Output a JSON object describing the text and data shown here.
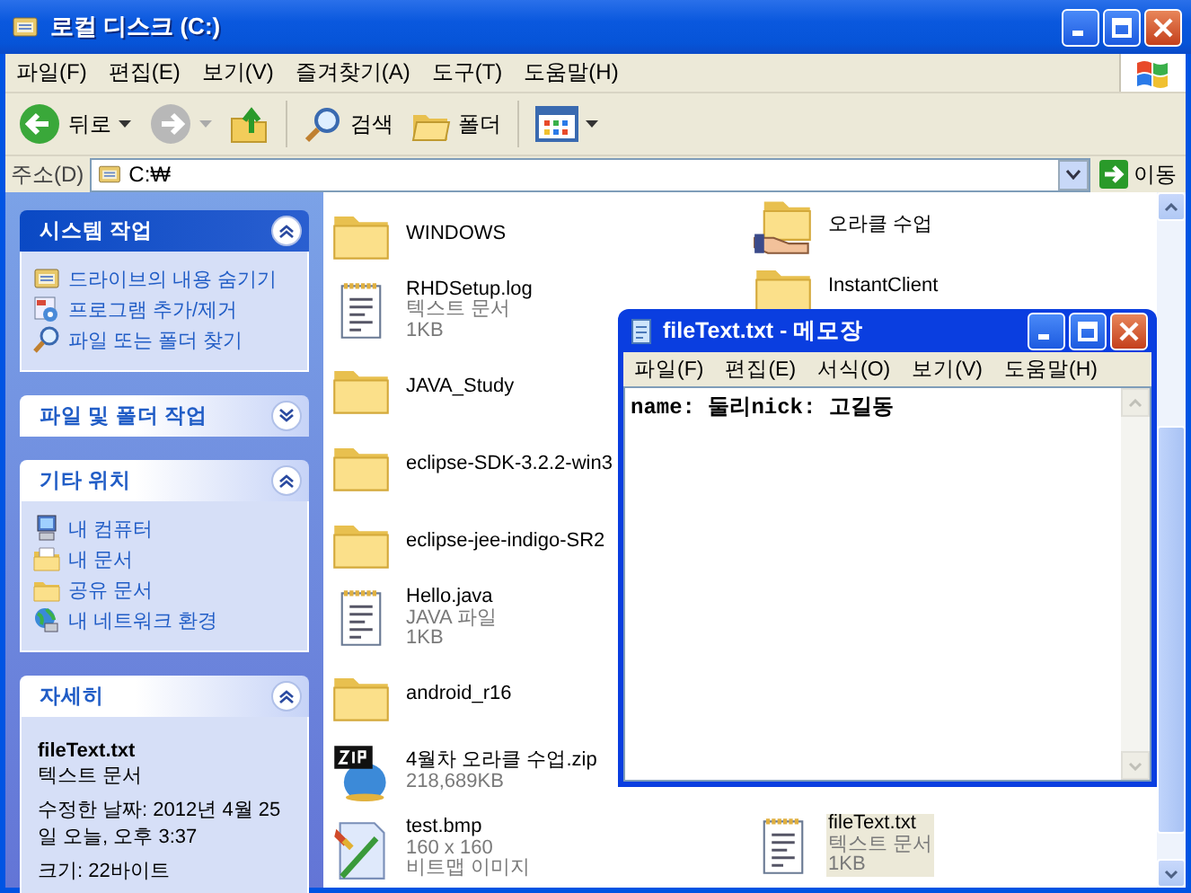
{
  "window": {
    "title": "로컬 디스크 (C:)"
  },
  "menu": [
    "파일(F)",
    "편집(E)",
    "보기(V)",
    "즐겨찾기(A)",
    "도구(T)",
    "도움말(H)"
  ],
  "toolbar": {
    "back": "뒤로",
    "search": "검색",
    "folders": "폴더"
  },
  "address": {
    "label": "주소(D)",
    "value": "C:₩",
    "go": "이동"
  },
  "task_panes": [
    {
      "title": "시스템 작업",
      "expanded": true,
      "items": [
        {
          "kind": "drive",
          "label": "드라이브의 내용 숨기기"
        },
        {
          "kind": "programs",
          "label": "프로그램 추가/제거"
        },
        {
          "kind": "search",
          "label": "파일 또는 폴더 찾기"
        }
      ]
    },
    {
      "title": "파일 및 폴더 작업",
      "expanded": false
    },
    {
      "title": "기타 위치",
      "expanded": true,
      "items": [
        {
          "kind": "computer",
          "label": "내 컴퓨터"
        },
        {
          "kind": "documents",
          "label": "내 문서"
        },
        {
          "kind": "shared",
          "label": "공유 문서"
        },
        {
          "kind": "network",
          "label": "내 네트워크 환경"
        }
      ]
    },
    {
      "title": "자세히",
      "expanded": true,
      "details": {
        "name": "fileText.txt",
        "type": "텍스트 문서",
        "modified": "수정한 날짜: 2012년 4월 25일 오늘, 오후 3:37",
        "size": "크기: 22바이트"
      }
    }
  ],
  "files": [
    [
      {
        "kind": "folder",
        "name": "WINDOWS",
        "selected": false
      },
      {
        "kind": "text",
        "name": "RHDSetup.log",
        "lines": [
          "텍스트 문서",
          "1KB"
        ],
        "selected": false
      },
      {
        "kind": "folder",
        "name": "JAVA_Study",
        "selected": false
      },
      {
        "kind": "folder",
        "name": "eclipse-SDK-3.2.2-win3",
        "selected": false
      },
      {
        "kind": "folder",
        "name": "eclipse-jee-indigo-SR2",
        "selected": false
      },
      {
        "kind": "text",
        "name": "Hello.java",
        "lines": [
          "JAVA 파일",
          "1KB"
        ],
        "selected": false
      },
      {
        "kind": "folder",
        "name": "android_r16",
        "selected": false
      },
      {
        "kind": "zip",
        "name": "4월차 오라클 수업.zip",
        "lines": [
          "218,689KB"
        ],
        "selected": false
      },
      {
        "kind": "image",
        "name": "test.bmp",
        "lines": [
          "160 x 160",
          "비트맵 이미지"
        ],
        "selected": false
      }
    ],
    [
      {
        "kind": "shared-folder",
        "name": "오라클 수업",
        "selected": false
      },
      {
        "kind": "folder",
        "name": "InstantClient",
        "selected": false
      },
      {
        "kind": "text",
        "name": "fileText.txt",
        "lines": [
          "텍스트 문서",
          "1KB"
        ],
        "selected": true
      }
    ]
  ],
  "notepad": {
    "title": "fileText.txt - 메모장",
    "menu": [
      "파일(F)",
      "편집(E)",
      "서식(O)",
      "보기(V)",
      "도움말(H)"
    ],
    "text": "name: 둘리nick: 고길동"
  }
}
